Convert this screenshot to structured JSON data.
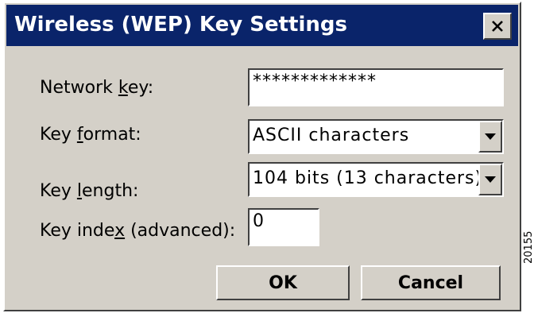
{
  "dialog": {
    "title": "Wireless (WEP) Key Settings",
    "close_icon": "close-icon"
  },
  "network_key": {
    "label_pre": "Network ",
    "label_acc": "k",
    "label_post": "ey:",
    "value": "*************"
  },
  "key_format": {
    "label_pre": "Key ",
    "label_acc": "f",
    "label_post": "ormat:",
    "value": "ASCII characters",
    "dropdown_icon": "chevron-down-icon"
  },
  "key_length": {
    "label_pre": "Key ",
    "label_acc": "l",
    "label_post": "ength:",
    "value": "104 bits (13 characters)",
    "dropdown_icon": "chevron-down-icon"
  },
  "key_index": {
    "label_pre": "Key inde",
    "label_acc": "x",
    "label_post": " (advanced):",
    "value": "0"
  },
  "buttons": {
    "ok": "OK",
    "cancel": "Cancel"
  },
  "figure_id": "20155"
}
